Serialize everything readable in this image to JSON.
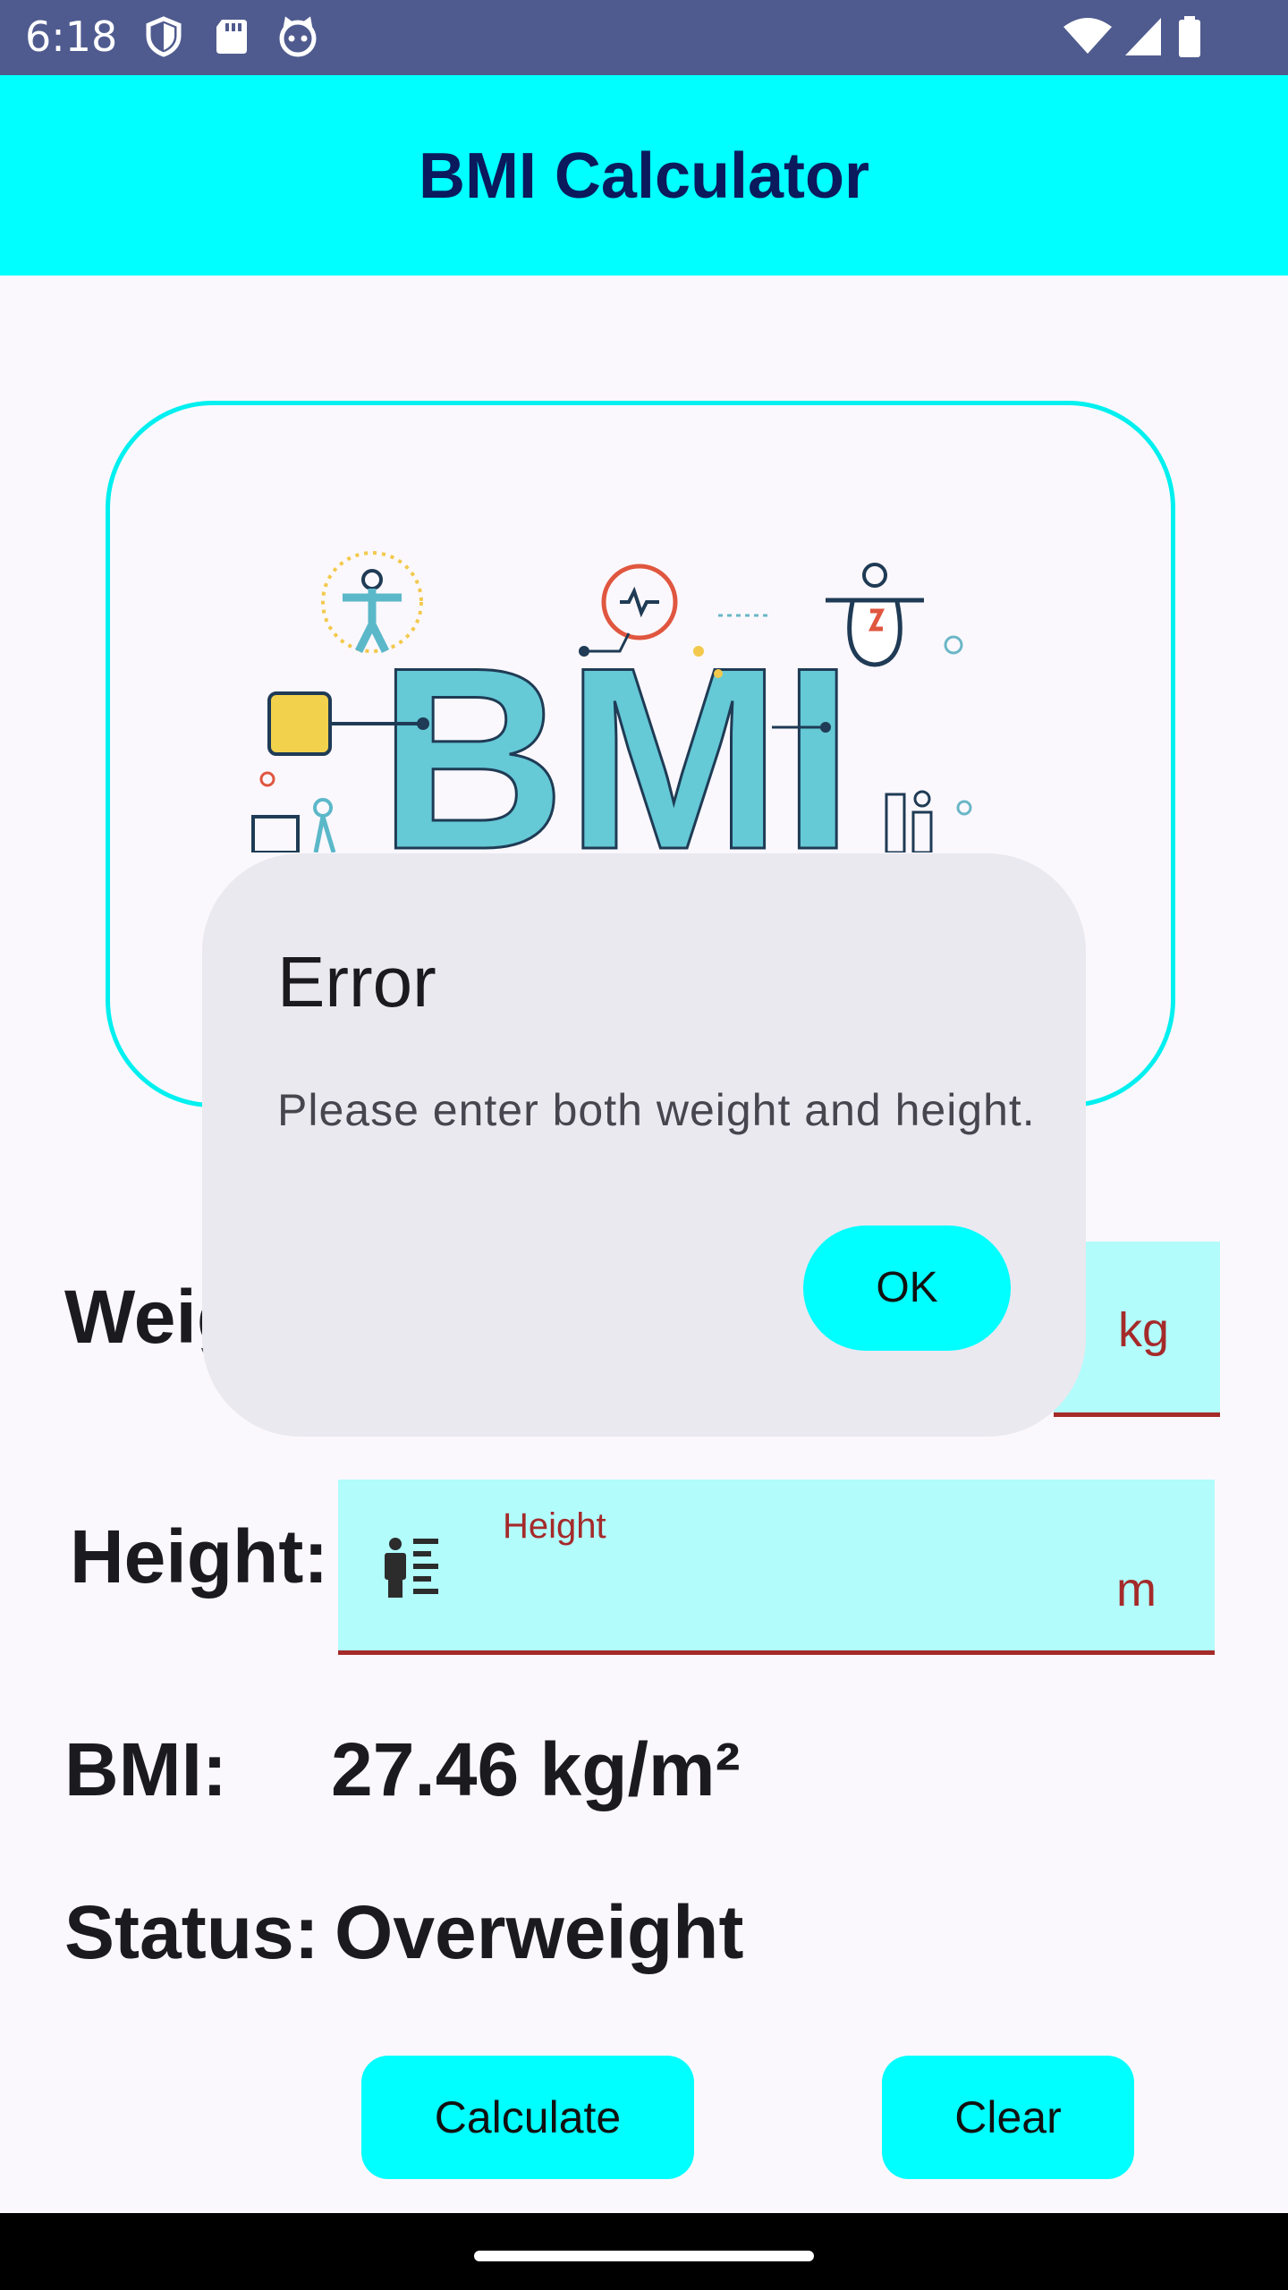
{
  "status_bar": {
    "time": "6:18",
    "left_icons": [
      "shield-icon",
      "sd-card-icon",
      "cat-face-icon"
    ],
    "right_icons": [
      "wifi-icon",
      "signal-icon",
      "battery-icon"
    ]
  },
  "app_bar": {
    "title": "BMI Calculator",
    "color": "#00ffff"
  },
  "hero_image": {
    "text": "BMI"
  },
  "form": {
    "weight": {
      "label": "Weig",
      "unit": "kg"
    },
    "height": {
      "label": "Height:",
      "floating_label": "Height",
      "unit": "m",
      "icon": "height-measure-icon"
    }
  },
  "result": {
    "bmi_label": "BMI:",
    "bmi_value": "27.46 kg/m²",
    "status_label": "Status:",
    "status_value": "Overweight"
  },
  "buttons": {
    "calculate": "Calculate",
    "clear": "Clear"
  },
  "dialog": {
    "title": "Error",
    "message": "Please enter both weight and height.",
    "ok": "OK"
  },
  "colors": {
    "accent": "#00ffff",
    "field_bg": "#b2fcfc",
    "error": "#a52a2a",
    "status_bar": "#4f5b8f"
  }
}
